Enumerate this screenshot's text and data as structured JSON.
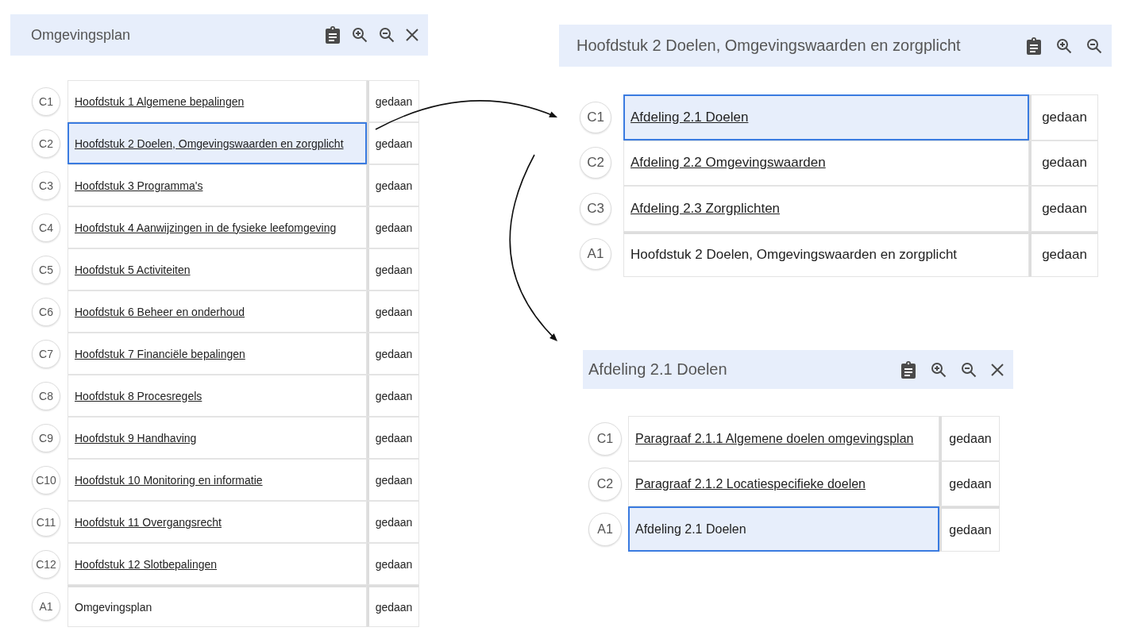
{
  "panels": [
    {
      "title": "Omgevingsplan",
      "tools": [
        {
          "kind": "clipboard"
        },
        {
          "kind": "zoom-in"
        },
        {
          "kind": "zoom-out"
        },
        {
          "kind": "close"
        }
      ],
      "rows": [
        {
          "label": "C1",
          "text": "Hoofdstuk 1 Algemene bepalingen",
          "kind": "link",
          "selected": false,
          "status": "gedaan"
        },
        {
          "label": "C2",
          "text": "Hoofdstuk 2 Doelen, Omgevingswaarden en zorgplicht",
          "kind": "link",
          "selected": true,
          "status": "gedaan"
        },
        {
          "label": "C3",
          "text": "Hoofdstuk 3 Programma's",
          "kind": "link",
          "selected": false,
          "status": "gedaan"
        },
        {
          "label": "C4",
          "text": "Hoofdstuk 4 Aanwijzingen in de fysieke leefomgeving",
          "kind": "link",
          "selected": false,
          "status": "gedaan"
        },
        {
          "label": "C5",
          "text": "Hoofdstuk 5 Activiteiten",
          "kind": "link",
          "selected": false,
          "status": "gedaan"
        },
        {
          "label": "C6",
          "text": "Hoofdstuk 6 Beheer en onderhoud",
          "kind": "link",
          "selected": false,
          "status": "gedaan"
        },
        {
          "label": "C7",
          "text": "Hoofdstuk 7 Financiële bepalingen",
          "kind": "link",
          "selected": false,
          "status": "gedaan"
        },
        {
          "label": "C8",
          "text": "Hoofdstuk 8 Procesregels",
          "kind": "link",
          "selected": false,
          "status": "gedaan"
        },
        {
          "label": "C9",
          "text": "Hoofdstuk 9 Handhaving",
          "kind": "link",
          "selected": false,
          "status": "gedaan"
        },
        {
          "label": "C10",
          "text": "Hoofdstuk 10 Monitoring en informatie",
          "kind": "link",
          "selected": false,
          "status": "gedaan"
        },
        {
          "label": "C11",
          "text": "Hoofdstuk 11 Overgangsrecht",
          "kind": "link",
          "selected": false,
          "status": "gedaan"
        },
        {
          "label": "C12",
          "text": "Hoofdstuk 12 Slotbepalingen",
          "kind": "link",
          "selected": false,
          "status": "gedaan"
        },
        {
          "label": "A1",
          "text": "Omgevingsplan",
          "kind": "plain",
          "selected": false,
          "status": "gedaan"
        }
      ]
    },
    {
      "title": "Hoofdstuk 2 Doelen, Omgevingswaarden en zorgplicht",
      "tools": [
        {
          "kind": "clipboard"
        },
        {
          "kind": "zoom-in"
        },
        {
          "kind": "zoom-out"
        }
      ],
      "rows": [
        {
          "label": "C1",
          "text": "Afdeling 2.1 Doelen",
          "kind": "link",
          "selected": true,
          "status": "gedaan"
        },
        {
          "label": "C2",
          "text": "Afdeling 2.2 Omgevingswaarden",
          "kind": "link",
          "selected": false,
          "status": "gedaan"
        },
        {
          "label": "C3",
          "text": "Afdeling 2.3 Zorgplichten",
          "kind": "link",
          "selected": false,
          "status": "gedaan"
        },
        {
          "label": "A1",
          "text": "Hoofdstuk 2 Doelen, Omgevingswaarden en zorgplicht",
          "kind": "plain",
          "selected": false,
          "status": "gedaan"
        }
      ]
    },
    {
      "title": "Afdeling 2.1 Doelen",
      "tools": [
        {
          "kind": "clipboard"
        },
        {
          "kind": "zoom-in"
        },
        {
          "kind": "zoom-out"
        },
        {
          "kind": "close"
        }
      ],
      "rows": [
        {
          "label": "C1",
          "text": "Paragraaf 2.1.1 Algemene doelen omgevingsplan",
          "kind": "link",
          "selected": false,
          "status": "gedaan"
        },
        {
          "label": "C2",
          "text": "Paragraaf 2.1.2 Locatiespecifieke doelen",
          "kind": "link",
          "selected": false,
          "status": "gedaan"
        },
        {
          "label": "A1",
          "text": "Afdeling 2.1 Doelen",
          "kind": "plain",
          "selected": true,
          "status": "gedaan"
        }
      ]
    }
  ]
}
